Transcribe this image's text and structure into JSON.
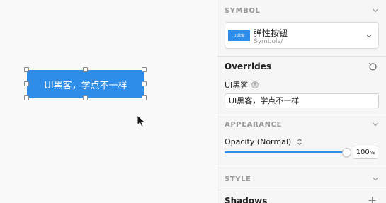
{
  "canvas": {
    "symbol_button_text": "UI黑客，学点不一样",
    "symbol_button_color": "#2e8de8"
  },
  "inspector": {
    "symbol": {
      "header": "SYMBOL",
      "thumb_text": "UI黑客",
      "name": "弹性按钮",
      "path": "Symbols/"
    },
    "overrides": {
      "title": "Overrides",
      "layer_label": "UI黑客",
      "text_value": "UI黑客，学点不一样"
    },
    "appearance": {
      "header": "APPEARANCE",
      "opacity_label": "Opacity (Normal)",
      "opacity_value": "100",
      "opacity_unit": "%",
      "opacity_fraction": 1.0
    },
    "style": {
      "header": "STYLE",
      "shadows_title": "Shadows"
    }
  },
  "colors": {
    "accent": "#2e8de8",
    "panel_bg": "#f6f6f6",
    "canvas_bg": "#f9f9f9"
  }
}
